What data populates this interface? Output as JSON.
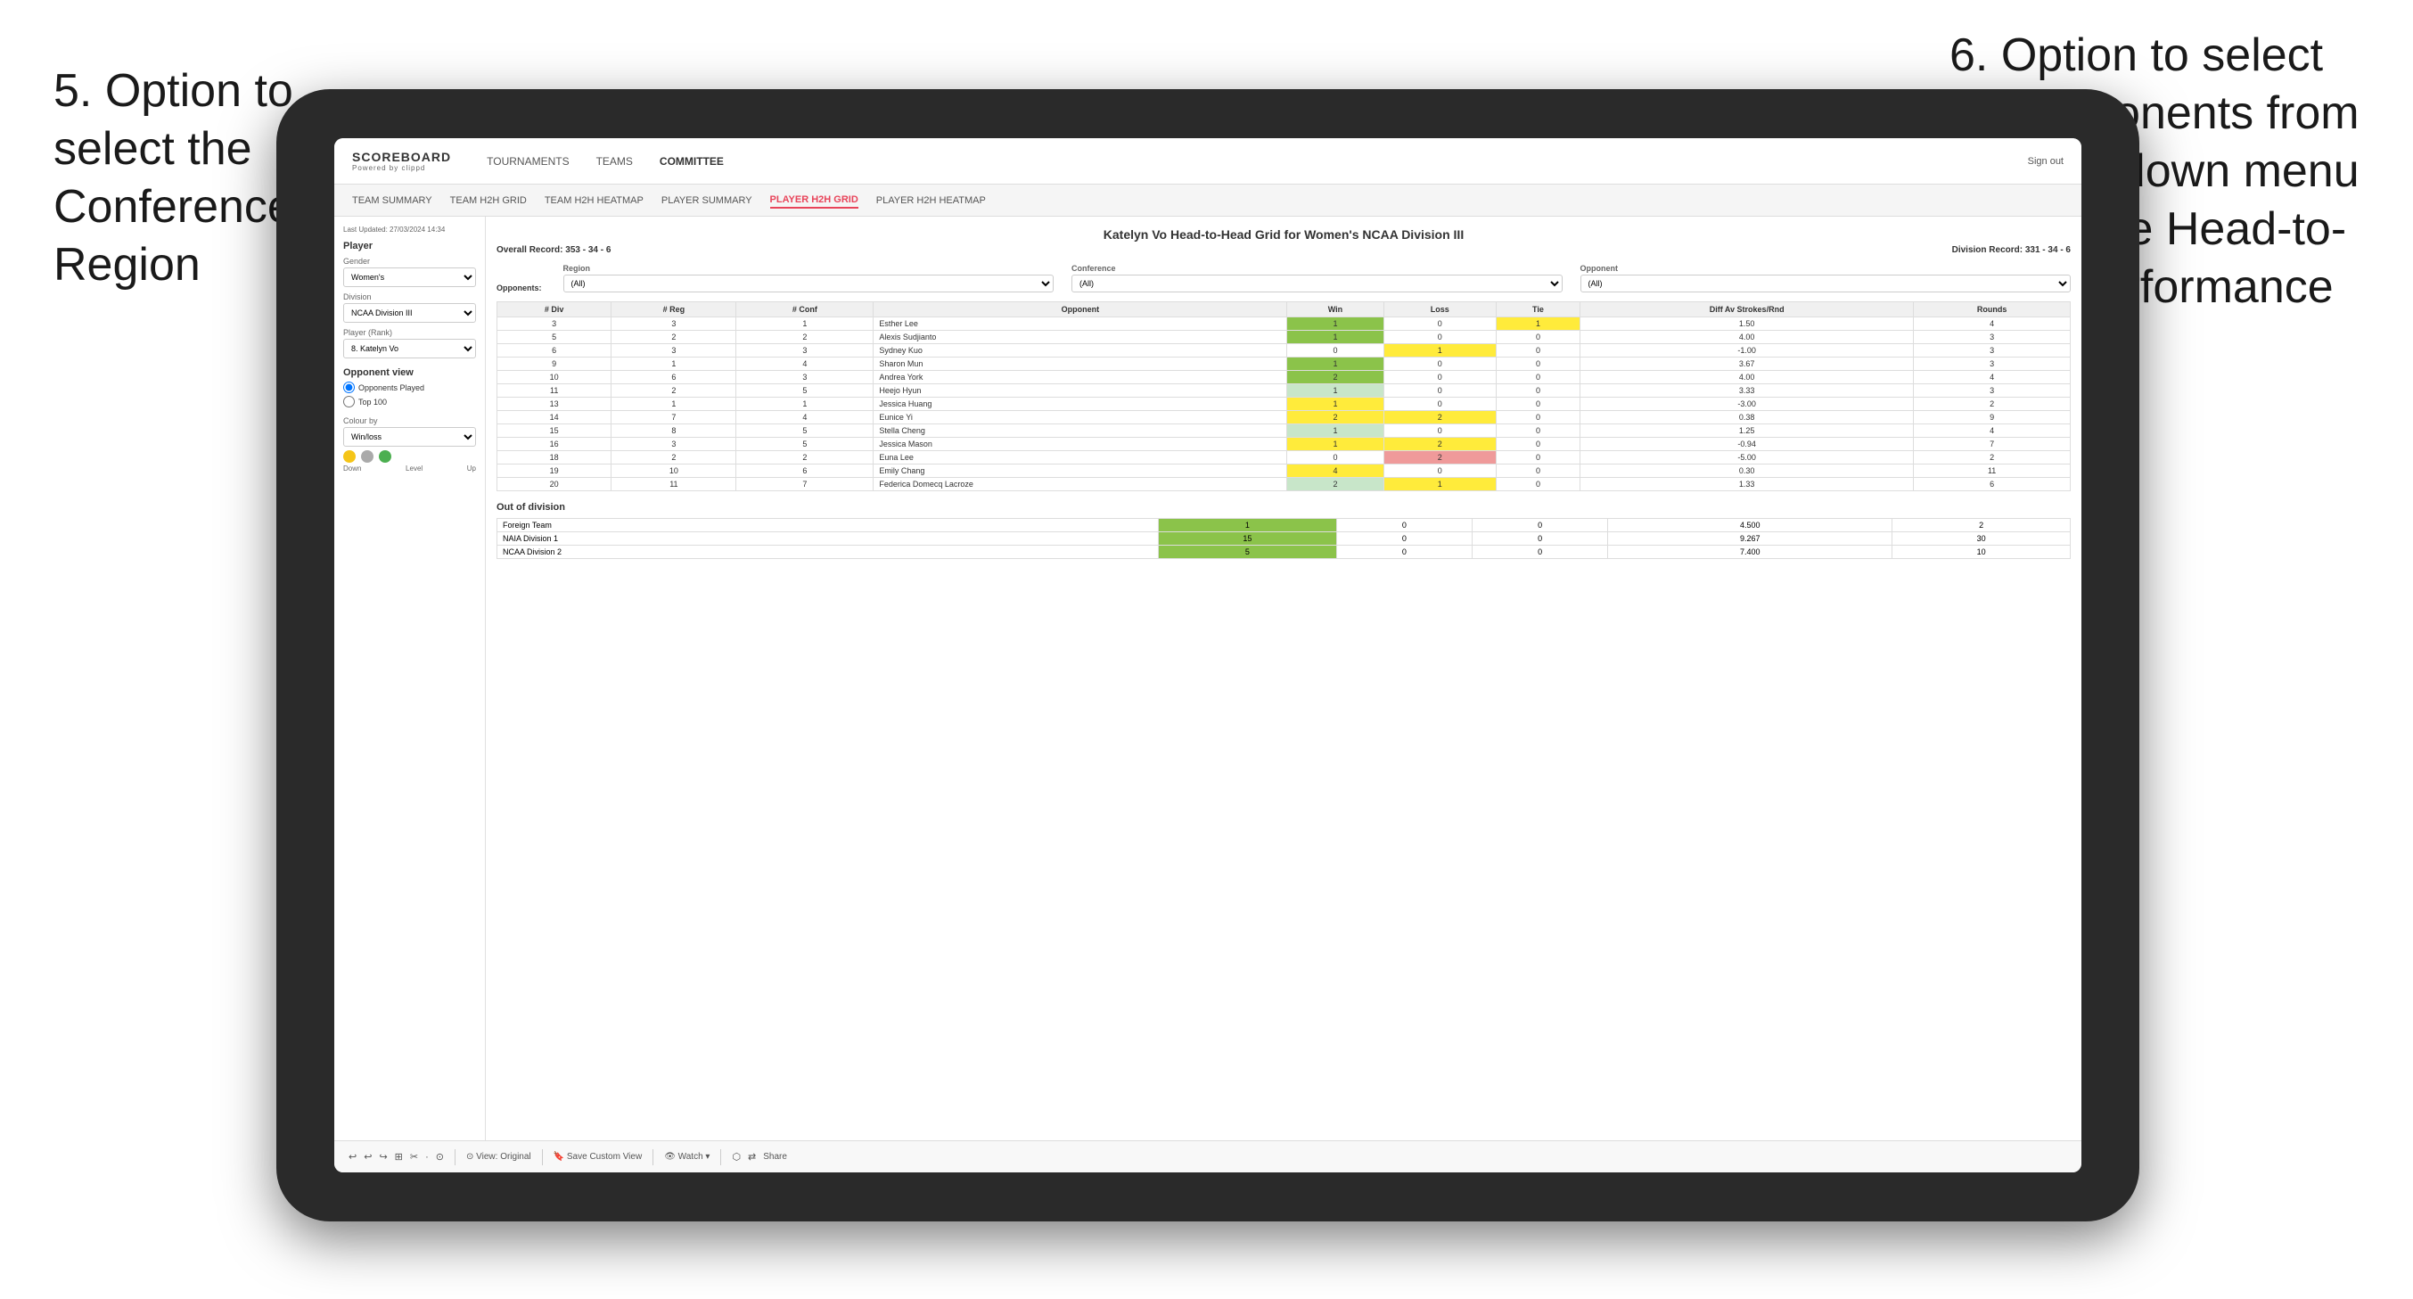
{
  "annotations": {
    "left_title": "5. Option to select the Conference and Region",
    "right_title": "6. Option to select the Opponents from the dropdown menu to see the Head-to-Head performance"
  },
  "nav": {
    "logo": "SCOREBOARD",
    "logo_sub": "Powered by clippd",
    "links": [
      "TOURNAMENTS",
      "TEAMS",
      "COMMITTEE"
    ],
    "sign_out": "Sign out"
  },
  "sub_nav": {
    "links": [
      "TEAM SUMMARY",
      "TEAM H2H GRID",
      "TEAM H2H HEATMAP",
      "PLAYER SUMMARY",
      "PLAYER H2H GRID",
      "PLAYER H2H HEATMAP"
    ],
    "active": "PLAYER H2H GRID"
  },
  "sidebar": {
    "last_updated": "Last Updated: 27/03/2024 14:34",
    "player_section": "Player",
    "gender_label": "Gender",
    "gender_value": "Women's",
    "division_label": "Division",
    "division_value": "NCAA Division III",
    "player_rank_label": "Player (Rank)",
    "player_rank_value": "8. Katelyn Vo",
    "opponent_view_title": "Opponent view",
    "radio_played": "Opponents Played",
    "radio_top": "Top 100",
    "colour_label": "Colour by",
    "colour_value": "Win/loss",
    "dot_labels": [
      "Down",
      "Level",
      "Up"
    ]
  },
  "grid": {
    "title": "Katelyn Vo Head-to-Head Grid for Women's NCAA Division III",
    "overall_record": "Overall Record: 353 - 34 - 6",
    "division_record": "Division Record: 331 - 34 - 6",
    "filter_row": {
      "opponents_label": "Opponents:",
      "region_label": "Region",
      "region_value": "(All)",
      "conference_label": "Conference",
      "conference_value": "(All)",
      "opponent_label": "Opponent",
      "opponent_value": "(All)"
    },
    "table_headers": [
      "# Div",
      "# Reg",
      "# Conf",
      "Opponent",
      "Win",
      "Loss",
      "Tie",
      "Diff Av Strokes/Rnd",
      "Rounds"
    ],
    "rows": [
      {
        "div": 3,
        "reg": 3,
        "conf": 1,
        "opponent": "Esther Lee",
        "win": 1,
        "loss": 0,
        "tie": 1,
        "diff": "1.50",
        "rounds": 4,
        "win_color": "green",
        "loss_color": "white",
        "tie_color": "yellow"
      },
      {
        "div": 5,
        "reg": 2,
        "conf": 2,
        "opponent": "Alexis Sudjianto",
        "win": 1,
        "loss": 0,
        "tie": 0,
        "diff": "4.00",
        "rounds": 3,
        "win_color": "green",
        "loss_color": "white",
        "tie_color": "white"
      },
      {
        "div": 6,
        "reg": 3,
        "conf": 3,
        "opponent": "Sydney Kuo",
        "win": 0,
        "loss": 1,
        "tie": 0,
        "diff": "-1.00",
        "rounds": 3,
        "win_color": "white",
        "loss_color": "yellow",
        "tie_color": "white"
      },
      {
        "div": 9,
        "reg": 1,
        "conf": 4,
        "opponent": "Sharon Mun",
        "win": 1,
        "loss": 0,
        "tie": 0,
        "diff": "3.67",
        "rounds": 3,
        "win_color": "green",
        "loss_color": "white",
        "tie_color": "white"
      },
      {
        "div": 10,
        "reg": 6,
        "conf": 3,
        "opponent": "Andrea York",
        "win": 2,
        "loss": 0,
        "tie": 0,
        "diff": "4.00",
        "rounds": 4,
        "win_color": "green",
        "loss_color": "white",
        "tie_color": "white"
      },
      {
        "div": 11,
        "reg": 2,
        "conf": 5,
        "opponent": "Heejo Hyun",
        "win": 1,
        "loss": 0,
        "tie": 0,
        "diff": "3.33",
        "rounds": 3,
        "win_color": "light-green",
        "loss_color": "white",
        "tie_color": "white"
      },
      {
        "div": 13,
        "reg": 1,
        "conf": 1,
        "opponent": "Jessica Huang",
        "win": 1,
        "loss": 0,
        "tie": 0,
        "diff": "-3.00",
        "rounds": 2,
        "win_color": "yellow",
        "loss_color": "white",
        "tie_color": "white"
      },
      {
        "div": 14,
        "reg": 7,
        "conf": 4,
        "opponent": "Eunice Yi",
        "win": 2,
        "loss": 2,
        "tie": 0,
        "diff": "0.38",
        "rounds": 9,
        "win_color": "yellow",
        "loss_color": "yellow",
        "tie_color": "white"
      },
      {
        "div": 15,
        "reg": 8,
        "conf": 5,
        "opponent": "Stella Cheng",
        "win": 1,
        "loss": 0,
        "tie": 0,
        "diff": "1.25",
        "rounds": 4,
        "win_color": "light-green",
        "loss_color": "white",
        "tie_color": "white"
      },
      {
        "div": 16,
        "reg": 3,
        "conf": 5,
        "opponent": "Jessica Mason",
        "win": 1,
        "loss": 2,
        "tie": 0,
        "diff": "-0.94",
        "rounds": 7,
        "win_color": "yellow",
        "loss_color": "yellow",
        "tie_color": "white"
      },
      {
        "div": 18,
        "reg": 2,
        "conf": 2,
        "opponent": "Euna Lee",
        "win": 0,
        "loss": 2,
        "tie": 0,
        "diff": "-5.00",
        "rounds": 2,
        "win_color": "white",
        "loss_color": "red",
        "tie_color": "white"
      },
      {
        "div": 19,
        "reg": 10,
        "conf": 6,
        "opponent": "Emily Chang",
        "win": 4,
        "loss": 0,
        "tie": 0,
        "diff": "0.30",
        "rounds": 11,
        "win_color": "yellow",
        "loss_color": "white",
        "tie_color": "white"
      },
      {
        "div": 20,
        "reg": 11,
        "conf": 7,
        "opponent": "Federica Domecq Lacroze",
        "win": 2,
        "loss": 1,
        "tie": 0,
        "diff": "1.33",
        "rounds": 6,
        "win_color": "light-green",
        "loss_color": "yellow",
        "tie_color": "white"
      }
    ],
    "out_of_division_title": "Out of division",
    "out_rows": [
      {
        "name": "Foreign Team",
        "win": 1,
        "loss": 0,
        "tie": 0,
        "diff": "4.500",
        "rounds": 2
      },
      {
        "name": "NAIA Division 1",
        "win": 15,
        "loss": 0,
        "tie": 0,
        "diff": "9.267",
        "rounds": 30
      },
      {
        "name": "NCAA Division 2",
        "win": 5,
        "loss": 0,
        "tie": 0,
        "diff": "7.400",
        "rounds": 10
      }
    ]
  },
  "toolbar": {
    "items": [
      "↩",
      "↩",
      "↪",
      "⊞",
      "✂",
      "·",
      "⊙",
      "|",
      "⊙ View: Original",
      "|",
      "🔖 Save Custom View",
      "|",
      "👁 Watch ▾",
      "|",
      "⬡",
      "⇄",
      "Share"
    ]
  }
}
